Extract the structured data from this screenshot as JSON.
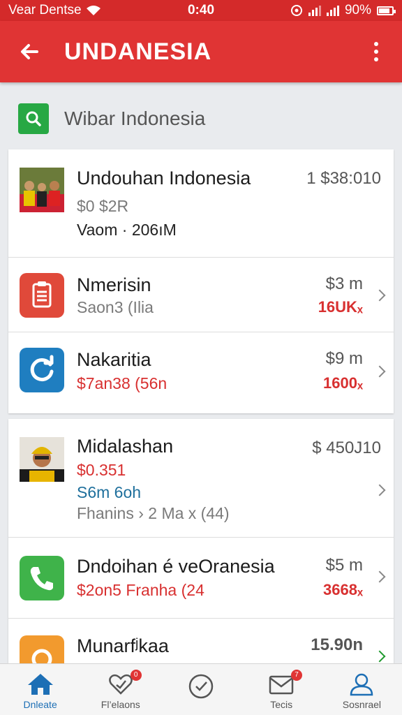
{
  "status_bar": {
    "carrier": "Vear Dentse",
    "time": "0:40",
    "battery": "90%"
  },
  "app_bar": {
    "title": "UNDANESIA"
  },
  "search": {
    "text": "Wibar Indonesia"
  },
  "group1": [
    {
      "name": "Undouhan Indonesia",
      "line2": "$0 $2R",
      "line3": "Vaom · 206ıM",
      "price": "1 $38:010",
      "icon": "photo-thumbnail"
    },
    {
      "name": "Nmerisin",
      "line2": "Saon3 (Ilia",
      "price": "$3 m",
      "sub": "16UKₓ",
      "icon": "clipboard-icon"
    },
    {
      "name": "Nakaritia",
      "line2": "$7an38 (56n",
      "price": "$9 m",
      "sub": "1600ₓ",
      "icon": "refresh-icon"
    }
  ],
  "group2": [
    {
      "name": "Midalashan",
      "line2": "$0.351",
      "line3": "S6m 6oh",
      "line4": "Fhanins › 2 Ma x (44)",
      "price": "$ 450J10",
      "icon": "avatar-thumbnail"
    },
    {
      "name": "Dndoihan é veOranesia",
      "line2": "$2on5 Franha (24",
      "price": "$5 m",
      "sub": "3668ₓ",
      "icon": "phone-icon"
    },
    {
      "name": "Munarfʲkaa",
      "price": "15.90n",
      "icon": "camera-icon"
    }
  ],
  "bottom_nav": [
    {
      "label": "Dnleate",
      "icon": "home-icon",
      "active": true
    },
    {
      "label": "Fl’elaons",
      "icon": "heart-icon",
      "badge": "0"
    },
    {
      "label": "",
      "icon": "check-circle-icon"
    },
    {
      "label": "Tecis",
      "icon": "mail-icon",
      "badge": "7"
    },
    {
      "label": "Sosnrael",
      "icon": "profile-icon"
    }
  ],
  "colors": {
    "primary_red": "#e03434",
    "status_red": "#d42a2a",
    "accent_blue": "#1d6fb5",
    "green": "#27a844"
  }
}
